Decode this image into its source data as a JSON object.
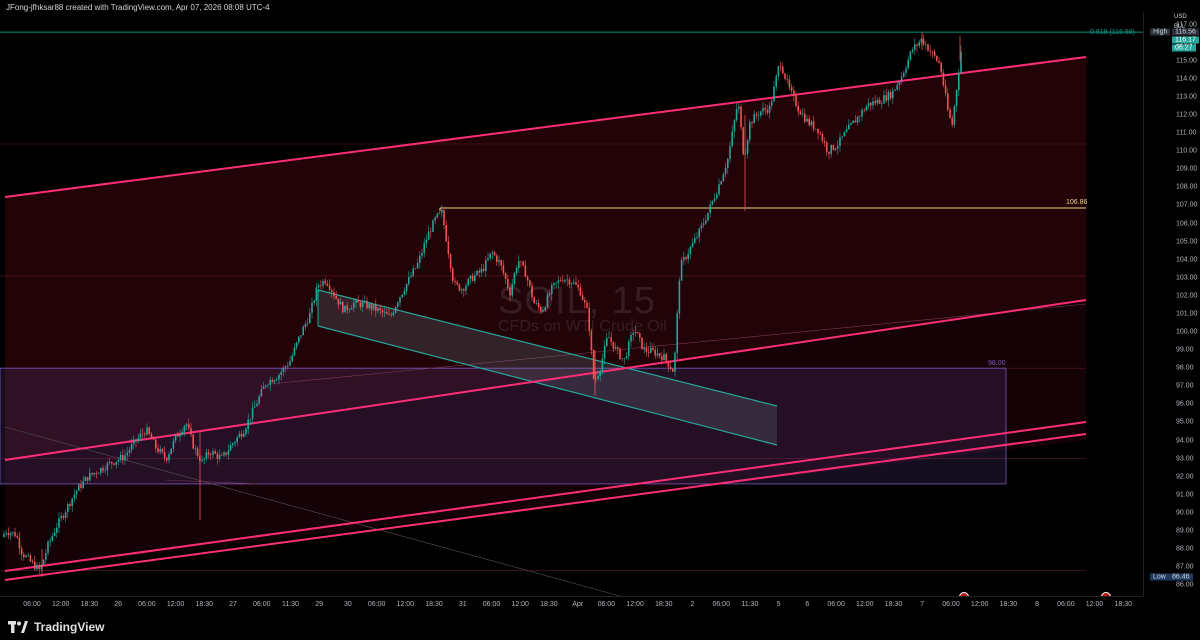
{
  "header": {
    "text": "JFong-jfhksar88 created with TradingView.com, Apr 07, 2026 08:08 UTC-4"
  },
  "price_scale": {
    "currency": "USD",
    "unit": "BLL"
  },
  "watermark": {
    "symbol": "SOIL, 15",
    "description": "CFDs on WTI Crude Oil"
  },
  "footer": {
    "brand": "TradingView"
  },
  "colors": {
    "channel": "#ff2e77",
    "channel_fill": "rgba(120,10,30,0.28)",
    "flag": "#26a69a",
    "zone": "#7e57c2",
    "level": "#f0d58c",
    "up": "#26a69a",
    "down": "#ef5350",
    "fib": "#089981"
  },
  "chart_data": {
    "type": "candlestick",
    "symbol": "SOIL",
    "timeframe": "15",
    "ylim": [
      85.4,
      117.7
    ],
    "y_ticks": [
      86.0,
      87.0,
      88.0,
      89.0,
      90.0,
      91.0,
      92.0,
      93.0,
      94.0,
      95.0,
      96.0,
      97.0,
      98.0,
      99.0,
      100.0,
      101.0,
      102.0,
      103.0,
      104.0,
      105.0,
      106.0,
      107.0,
      108.0,
      109.0,
      110.0,
      111.0,
      112.0,
      113.0,
      114.0,
      115.0,
      116.0,
      117.0
    ],
    "x_tick_labels": [
      "06:00",
      "12:00",
      "18:30",
      "26",
      "06:00",
      "12:00",
      "18:30",
      "27",
      "06:00",
      "11:30",
      "29",
      "30",
      "06:00",
      "12:00",
      "18:30",
      "31",
      "06:00",
      "12:00",
      "18:30",
      "Apr",
      "06:00",
      "12:00",
      "18:30",
      "2",
      "06:00",
      "11:30",
      "5",
      "6",
      "06:00",
      "12:00",
      "18:30",
      "7",
      "06:00",
      "12:00",
      "18:30",
      "8",
      "06:00",
      "12:00",
      "18:30",
      "9"
    ],
    "price_path": [
      [
        0,
        88.5
      ],
      [
        6,
        89.0
      ],
      [
        16,
        88.8
      ],
      [
        22,
        87.8
      ],
      [
        32,
        87.2
      ],
      [
        40,
        86.8
      ],
      [
        48,
        88.2
      ],
      [
        56,
        89.2
      ],
      [
        64,
        90.0
      ],
      [
        76,
        91.2
      ],
      [
        88,
        92.0
      ],
      [
        100,
        92.4
      ],
      [
        112,
        92.8
      ],
      [
        124,
        93.1
      ],
      [
        136,
        94.0
      ],
      [
        146,
        94.6
      ],
      [
        156,
        93.6
      ],
      [
        166,
        93.0
      ],
      [
        176,
        94.2
      ],
      [
        186,
        95.0
      ],
      [
        194,
        93.6
      ],
      [
        202,
        92.8
      ],
      [
        210,
        93.4
      ],
      [
        222,
        93.0
      ],
      [
        232,
        93.8
      ],
      [
        244,
        94.6
      ],
      [
        256,
        96.0
      ],
      [
        266,
        97.2
      ],
      [
        278,
        97.6
      ],
      [
        290,
        98.4
      ],
      [
        300,
        99.8
      ],
      [
        310,
        101.0
      ],
      [
        318,
        102.6
      ],
      [
        326,
        102.9
      ],
      [
        336,
        101.9
      ],
      [
        344,
        101.2
      ],
      [
        354,
        101.6
      ],
      [
        366,
        101.5
      ],
      [
        378,
        101.2
      ],
      [
        390,
        100.8
      ],
      [
        398,
        101.8
      ],
      [
        408,
        102.8
      ],
      [
        418,
        103.8
      ],
      [
        428,
        105.4
      ],
      [
        436,
        106.3
      ],
      [
        442,
        106.6
      ],
      [
        448,
        104.6
      ],
      [
        454,
        102.6
      ],
      [
        462,
        102.4
      ],
      [
        472,
        103.0
      ],
      [
        482,
        103.4
      ],
      [
        492,
        104.4
      ],
      [
        500,
        103.8
      ],
      [
        510,
        102.2
      ],
      [
        518,
        104.0
      ],
      [
        526,
        103.2
      ],
      [
        534,
        101.6
      ],
      [
        542,
        101.2
      ],
      [
        552,
        102.4
      ],
      [
        562,
        103.0
      ],
      [
        572,
        102.8
      ],
      [
        580,
        102.3
      ],
      [
        588,
        101.0
      ],
      [
        594,
        97.2
      ],
      [
        600,
        98.0
      ],
      [
        608,
        99.8
      ],
      [
        616,
        99.0
      ],
      [
        624,
        98.4
      ],
      [
        634,
        100.2
      ],
      [
        644,
        99.0
      ],
      [
        654,
        98.9
      ],
      [
        664,
        98.6
      ],
      [
        674,
        97.8
      ],
      [
        680,
        103.6
      ],
      [
        688,
        104.4
      ],
      [
        698,
        105.4
      ],
      [
        708,
        106.6
      ],
      [
        718,
        108.0
      ],
      [
        728,
        109.6
      ],
      [
        738,
        112.8
      ],
      [
        744,
        109.6
      ],
      [
        750,
        111.6
      ],
      [
        760,
        112.2
      ],
      [
        770,
        112.4
      ],
      [
        780,
        115.0
      ],
      [
        788,
        113.6
      ],
      [
        798,
        112.4
      ],
      [
        808,
        111.6
      ],
      [
        818,
        111.2
      ],
      [
        828,
        110.0
      ],
      [
        838,
        110.4
      ],
      [
        848,
        111.2
      ],
      [
        858,
        111.9
      ],
      [
        868,
        112.6
      ],
      [
        880,
        112.8
      ],
      [
        892,
        113.2
      ],
      [
        902,
        114.2
      ],
      [
        912,
        115.6
      ],
      [
        922,
        116.2
      ],
      [
        932,
        115.4
      ],
      [
        940,
        114.8
      ],
      [
        948,
        112.2
      ],
      [
        952,
        111.4
      ],
      [
        956,
        113.2
      ],
      [
        962,
        116.0
      ]
    ],
    "wick_extremes": {
      "high": 116.56,
      "low": 86.46
    },
    "last_price": 116.17,
    "countdown": "06:27",
    "annotations": {
      "fib_label": "0.618 (116.59)",
      "fib_level": 116.59,
      "resistance_level": 106.86,
      "resistance_label": "106.86",
      "zone_label": "98.00",
      "zone_top": 98.0,
      "zone_bottom": 91.6,
      "high_label": "High",
      "high_value": "116.56",
      "low_label": "Low",
      "low_value": "86.46",
      "last_value": "116.17"
    },
    "grid": true
  }
}
